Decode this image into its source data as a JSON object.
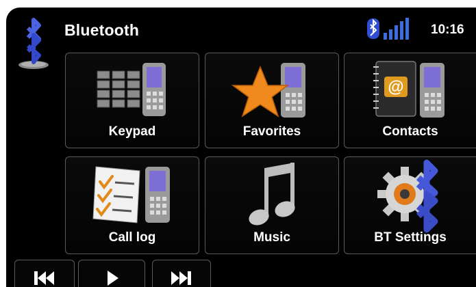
{
  "header": {
    "title": "Bluetooth",
    "time": "10:16",
    "icons": [
      "bluetooth-logo-icon",
      "bluetooth-signal-icon"
    ]
  },
  "tiles": [
    {
      "label": "Keypad",
      "icon": "keypad-phone-icon"
    },
    {
      "label": "Favorites",
      "icon": "star-phone-icon"
    },
    {
      "label": "Contacts",
      "icon": "address-book-phone-icon"
    },
    {
      "label": "Call log",
      "icon": "call-list-phone-icon"
    },
    {
      "label": "Music",
      "icon": "music-note-icon"
    },
    {
      "label": "BT Settings",
      "icon": "gear-bluetooth-icon"
    }
  ],
  "transport": [
    {
      "icon": "previous-track-icon"
    },
    {
      "icon": "play-icon"
    },
    {
      "icon": "next-track-icon"
    }
  ],
  "colors": {
    "background": "#000000",
    "accent_blue": "#3b55d9",
    "star_orange": "#f08a1c",
    "tile_border": "#5b5b5b"
  }
}
